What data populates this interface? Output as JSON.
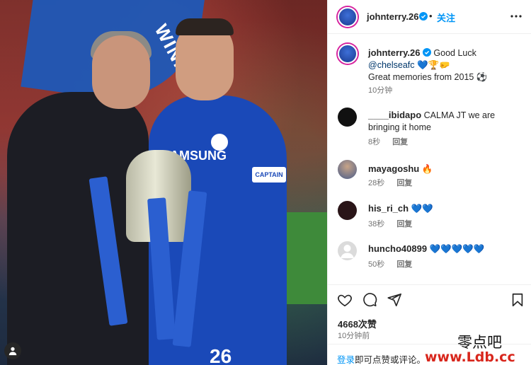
{
  "post": {
    "author": "johnterry.26",
    "follow_label": "关注",
    "caption_prefix": "Good Luck",
    "caption_mention": "@chelseafc",
    "caption_emojis": "💙🏆🤛",
    "caption_line2": "Great memories from 2015 ⚽",
    "caption_time": "10分钟",
    "likes": "4668次赞",
    "posted_ago": "10分钟前",
    "login_link": "登录",
    "login_rest": "即可点赞或评论。"
  },
  "photo": {
    "banner_text": "WINN",
    "armband": "CAPTAIN",
    "sponsor": "SAMSUNG",
    "shirt_number": "26"
  },
  "comments": [
    {
      "user": "____ibidapo",
      "text": "CALMA JT we are bringing it home",
      "time": "8秒",
      "reply": "回复",
      "avatar_color": "#111111"
    },
    {
      "user": "mayagoshu",
      "text": "🔥",
      "time": "28秒",
      "reply": "回复",
      "avatar_color": "#7a8aa3"
    },
    {
      "user": "his_ri_ch",
      "text": "💙💙",
      "time": "38秒",
      "reply": "回复",
      "avatar_color": "#2a1518"
    },
    {
      "user": "huncho40899",
      "text": "💙💙💙💙💙",
      "time": "50秒",
      "reply": "回复",
      "avatar_color": "#dcdcdc"
    }
  ],
  "watermark": {
    "top": "零点吧",
    "bottom": "www.Ldb.cc"
  },
  "icons": [
    "heart-icon",
    "comment-icon",
    "share-icon",
    "save-icon",
    "more-icon",
    "verified-icon",
    "user-icon"
  ],
  "colors": {
    "accent": "#0095f6",
    "chelsea_blue": "#1a49b8",
    "verified": "#0095f6"
  }
}
